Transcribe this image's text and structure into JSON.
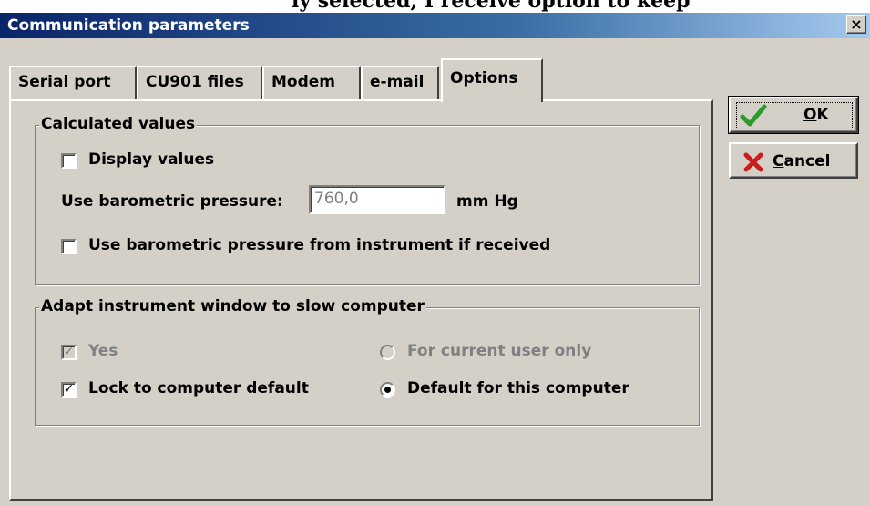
{
  "window": {
    "title": "Communication parameters",
    "close_glyph": "×"
  },
  "tabs": [
    {
      "label": "Serial port",
      "active": false
    },
    {
      "label": "CU901 files",
      "active": false
    },
    {
      "label": "Modem",
      "active": false
    },
    {
      "label": "e-mail",
      "active": false
    },
    {
      "label": "Options",
      "active": true
    }
  ],
  "calculated_values": {
    "title": "Calculated values",
    "display_values": {
      "label": "Display values",
      "checked": false
    },
    "pressure_label": "Use barometric pressure:",
    "pressure_value": "760,0",
    "pressure_unit": "mm Hg",
    "use_instrument_pressure": {
      "label": "Use barometric pressure from instrument if received",
      "checked": false
    }
  },
  "adapt_window": {
    "title": "Adapt instrument window to slow computer",
    "yes": {
      "label": "Yes",
      "checked": true,
      "enabled": false
    },
    "lock_default": {
      "label": "Lock to computer default",
      "checked": true
    },
    "current_user": {
      "label": "For current user only",
      "selected": false,
      "enabled": false
    },
    "this_computer": {
      "label": "Default for this computer",
      "selected": true
    }
  },
  "buttons": {
    "ok": {
      "mnemonic": "O",
      "rest": "K",
      "icon": "checkmark-icon",
      "icon_color": "#2a9a2a"
    },
    "cancel": {
      "mnemonic": "C",
      "rest": "ancel",
      "icon": "red-x-icon",
      "icon_color": "#c81e1e"
    }
  },
  "check_glyph": "✓",
  "background_caption": "ly selected, I receive option to keep"
}
